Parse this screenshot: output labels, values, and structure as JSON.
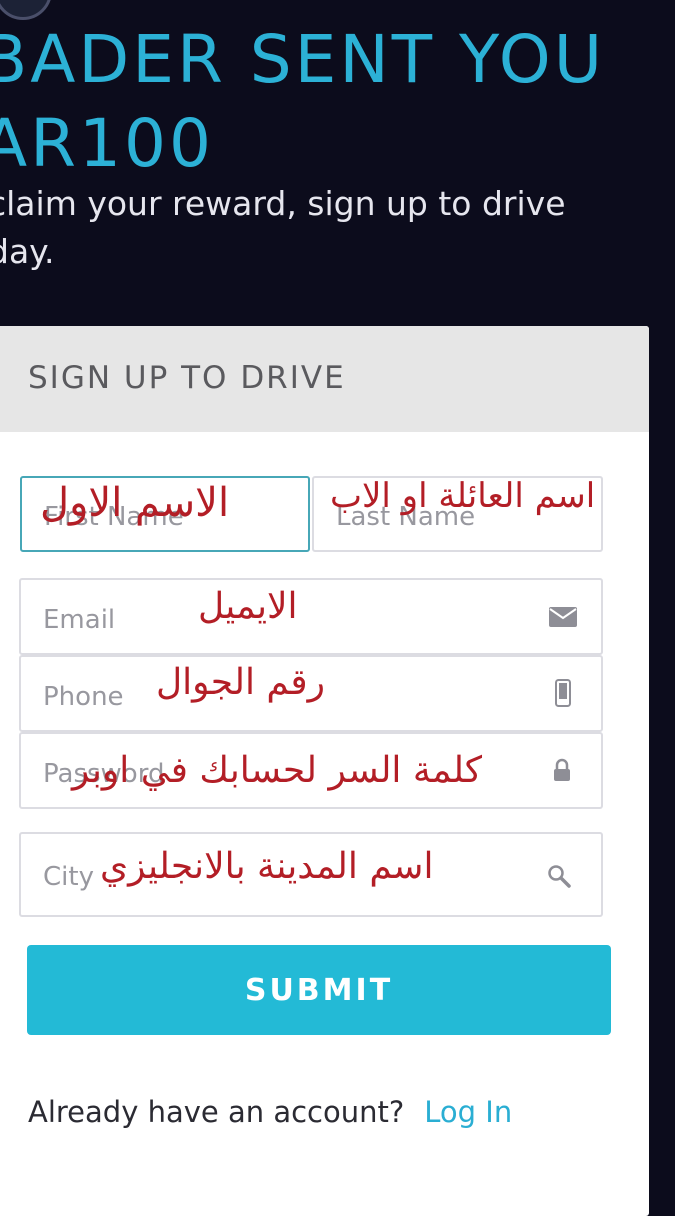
{
  "hero": {
    "headline_line1": "BADER SENT YOU",
    "headline_line2": "AR100",
    "subtext_line1": "claim your reward, sign up to drive",
    "subtext_line2": "day."
  },
  "form": {
    "title": "SIGN UP TO DRIVE",
    "fields": {
      "first_name": {
        "placeholder": "First Name",
        "annotation": "الاسم الاول"
      },
      "last_name": {
        "placeholder": "Last Name",
        "annotation": "اسم العائلة او الاب"
      },
      "email": {
        "placeholder": "Email",
        "annotation": "الايميل",
        "icon": "envelope-icon"
      },
      "phone": {
        "placeholder": "Phone",
        "annotation": "رقم الجوال",
        "icon": "phone-icon"
      },
      "password": {
        "placeholder": "Password",
        "annotation": "كلمة السر لحسابك في اوبر",
        "icon": "lock-icon"
      },
      "city": {
        "placeholder": "City",
        "annotation": "اسم المدينة بالانجليزي",
        "icon": "search-icon"
      }
    },
    "submit_label": "SUBMIT",
    "login_prompt": "Already have an account?",
    "login_link": "Log In"
  },
  "colors": {
    "background": "#0c0c1c",
    "accent": "#2cb1d6",
    "submit": "#23bad6",
    "annotation": "#b31e26"
  }
}
